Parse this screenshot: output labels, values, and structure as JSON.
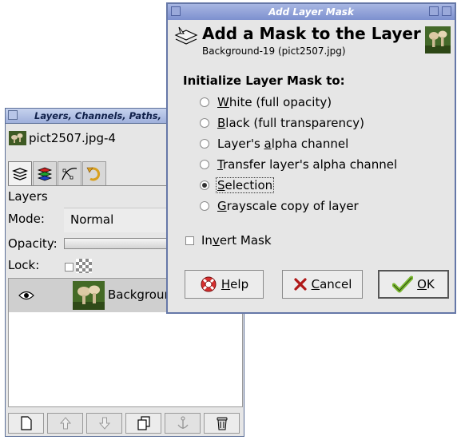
{
  "layers_window": {
    "title": "Layers, Channels, Paths,",
    "image_name": "pict2507.jpg-4",
    "section": "Layers",
    "mode_label": "Mode:",
    "mode_value": "Normal",
    "opacity_label": "Opacity:",
    "lock_label": "Lock:",
    "layer_name": "Backgrour",
    "tabs": [
      "layers-icon",
      "channels-icon",
      "paths-icon",
      "undo-history-icon"
    ],
    "bottom_buttons": [
      "new-layer-icon",
      "raise-layer-icon",
      "lower-layer-icon",
      "duplicate-layer-icon",
      "anchor-layer-icon",
      "delete-layer-icon"
    ]
  },
  "dialog": {
    "title": "Add Layer Mask",
    "header_title": "Add a Mask to the Layer",
    "header_subtitle": "Background-19 (pict2507.jpg)",
    "section_label": "Initialize Layer Mask to:",
    "options": [
      {
        "pre": "",
        "key": "W",
        "post": "hite (full opacity)",
        "selected": false
      },
      {
        "pre": "",
        "key": "B",
        "post": "lack (full transparency)",
        "selected": false
      },
      {
        "pre": "Layer's ",
        "key": "a",
        "post": "lpha channel",
        "selected": false
      },
      {
        "pre": "",
        "key": "T",
        "post": "ransfer layer's alpha channel",
        "selected": false
      },
      {
        "pre": "",
        "key": "S",
        "post": "election",
        "selected": true
      },
      {
        "pre": "",
        "key": "G",
        "post": "rayscale copy of layer",
        "selected": false
      }
    ],
    "invert": {
      "pre": "In",
      "key": "v",
      "post": "ert Mask",
      "checked": false
    },
    "buttons": {
      "help": {
        "pre": "",
        "key": "H",
        "post": "elp"
      },
      "cancel": {
        "pre": "",
        "key": "C",
        "post": "ancel"
      },
      "ok": {
        "pre": "",
        "key": "O",
        "post": "K"
      }
    }
  },
  "colors": {
    "titlebar": "#9fb0db",
    "dialog_titlebar": "#7d90cf",
    "window_bg": "#e6e6e6",
    "selected_row": "#cfcfcf"
  }
}
